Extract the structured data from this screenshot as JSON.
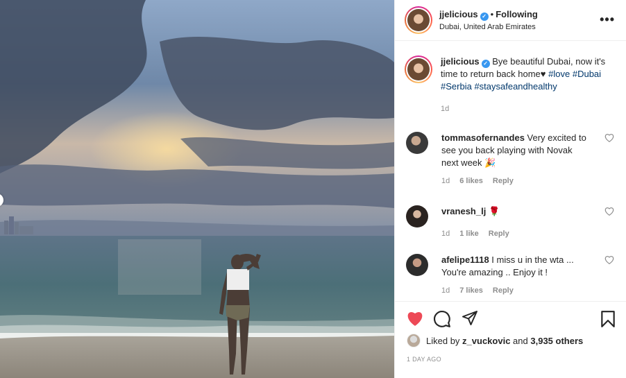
{
  "post": {
    "username": "jjelicious",
    "verified_mark": "✓",
    "separator": "•",
    "follow_state": "Following",
    "location": "Dubai, United Arab Emirates",
    "more_label": "•••"
  },
  "caption": {
    "username": "jjelicious",
    "text": "Bye beautiful Dubai, now it's time to return back home♥",
    "hashtags": [
      "#love",
      "#Dubai",
      "#Serbia",
      "#staysafeandhealthy"
    ],
    "time": "1d"
  },
  "comments": [
    {
      "username": "tommasofernandes",
      "text": "Very excited to see you back playing with Novak next week",
      "emoji": "🎉",
      "time": "1d",
      "likes": "6 likes",
      "reply": "Reply",
      "avatar_color": "#3a3a3a"
    },
    {
      "username": "vranesh_lj",
      "text": "",
      "emoji": "🌹",
      "time": "1d",
      "likes": "1 like",
      "reply": "Reply",
      "avatar_color": "#2a2320"
    },
    {
      "username": "afelipe1118",
      "text": "I miss u in the wta ... You're amazing .. Enjoy it !",
      "emoji": "",
      "time": "1d",
      "likes": "7 likes",
      "reply": "Reply",
      "avatar_color": "#2c2c2c"
    }
  ],
  "actions": {
    "icons": [
      "heart-icon",
      "comment-icon",
      "share-icon",
      "bookmark-icon"
    ],
    "like_color": "#ed4956"
  },
  "liked_by": {
    "prefix": "Liked by",
    "user": "z_vuckovic",
    "middle": "and",
    "others": "3,935 others"
  },
  "timestamp": "1 DAY AGO"
}
